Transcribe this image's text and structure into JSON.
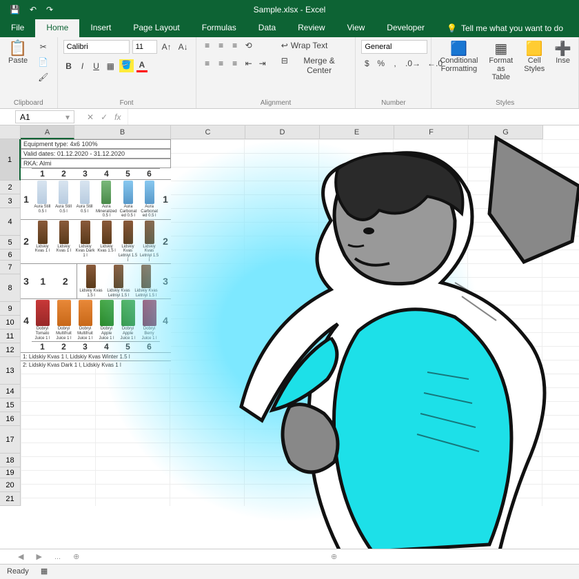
{
  "app": {
    "title": "Sample.xlsx - Excel",
    "tell_me": "Tell me what you want to do"
  },
  "tabs": {
    "file": "File",
    "home": "Home",
    "insert": "Insert",
    "pagelayout": "Page Layout",
    "formulas": "Formulas",
    "data": "Data",
    "review": "Review",
    "view": "View",
    "developer": "Developer"
  },
  "ribbon": {
    "clipboard": {
      "label": "Clipboard",
      "paste": "Paste"
    },
    "font": {
      "label": "Font",
      "name": "Calibri",
      "size": "11"
    },
    "alignment": {
      "label": "Alignment",
      "wrap": "Wrap Text",
      "merge": "Merge & Center"
    },
    "number": {
      "label": "Number",
      "format": "General"
    },
    "styles": {
      "label": "Styles",
      "cond": "Conditional Formatting",
      "fmt_table": "Format as Table",
      "cell_styles": "Cell Styles",
      "insert": "Inse"
    }
  },
  "formula": {
    "namebox": "A1",
    "fx": "fx"
  },
  "columns": [
    "A",
    "B",
    "C",
    "D",
    "E",
    "F",
    "G"
  ],
  "rows": [
    1,
    2,
    3,
    4,
    5,
    6,
    7,
    8,
    9,
    10,
    11,
    12,
    13,
    14,
    15,
    16,
    17,
    18,
    19,
    20,
    21
  ],
  "row_heights": {
    "1": 60,
    "4": 40,
    "6": 16,
    "8": 40,
    "13": 40,
    "17": 40,
    "19": 16
  },
  "planogram": {
    "equipment": "Equipment type: 4x6 100%",
    "dates": "Valid dates: 01.12.2020 - 31.12.2020",
    "rka": "RKA: Almi",
    "cols": [
      "1",
      "2",
      "3",
      "4",
      "5",
      "6"
    ],
    "shelf1": {
      "label": "1",
      "items": [
        {
          "cls": "bottle-clear",
          "txt": "Aura Still 0.5 l"
        },
        {
          "cls": "bottle-clear",
          "txt": "Aura Still 0.5 l"
        },
        {
          "cls": "bottle-clear",
          "txt": "Aura Still 0.5 l"
        },
        {
          "cls": "bottle-green",
          "txt": "Aura Mineralized 0.5 l"
        },
        {
          "cls": "bottle-blue",
          "txt": "Aura Carbonat ed 0.5 l"
        },
        {
          "cls": "bottle-blue",
          "txt": "Aura Carbonat ed 0.5 l"
        }
      ]
    },
    "shelf2": {
      "label": "2",
      "items": [
        {
          "cls": "bottle-brown",
          "txt": "Lidskiy Kvas 1 l"
        },
        {
          "cls": "bottle-brown",
          "txt": "Lidskiy Kvas 1 l"
        },
        {
          "cls": "bottle-brown",
          "txt": "Lidskiy Kvas Dark 1 l"
        },
        {
          "cls": "bottle-brown",
          "txt": "Lidskiy Kvas 1.5 l"
        },
        {
          "cls": "bottle-brown",
          "txt": "Lidskiy Kvas Letniyi 1.5 l"
        },
        {
          "cls": "bottle-brown",
          "txt": "Lidskiy Kvas Letniyi 1.5 l"
        }
      ]
    },
    "shelf3": {
      "label": "3",
      "left": [
        "1",
        "2"
      ],
      "items": [
        {
          "cls": "bottle-brown",
          "txt": "Lidskiy Kvas 1.5 l"
        },
        {
          "cls": "bottle-brown",
          "txt": "Lidskiy Kvas Letniyi 1.5 l"
        },
        {
          "cls": "bottle-brown",
          "txt": "Lidskiy Kvas Letniyi 1.5 l"
        }
      ]
    },
    "shelf4": {
      "label": "4",
      "items": [
        {
          "cls": "carton-red",
          "txt": "Dobryi Tomato Juice 1 l"
        },
        {
          "cls": "carton-orange",
          "txt": "Dobryi Multifruit Juice 1 l"
        },
        {
          "cls": "carton-orange",
          "txt": "Dobryi Multifruit Juice 1 l"
        },
        {
          "cls": "carton-green",
          "txt": "Dobryi Apple Juice 1 l"
        },
        {
          "cls": "carton-green",
          "txt": "Dobryi Apple Juice 1 l"
        },
        {
          "cls": "carton-dred",
          "txt": "Dobryi Berry Juice 1 l"
        }
      ]
    },
    "notes": [
      "1: Lidskiy Kvas 1 l, Lidskiy Kvas Winter 1.5 l",
      "2: Lidskiy Kvas Dark 1 l, Lidskiy Kvas 1 l"
    ]
  },
  "sheet_tabs": {
    "nav1": "◀",
    "nav2": "▶",
    "dots": "...",
    "plus": "⊕"
  },
  "status": {
    "ready": "Ready"
  }
}
